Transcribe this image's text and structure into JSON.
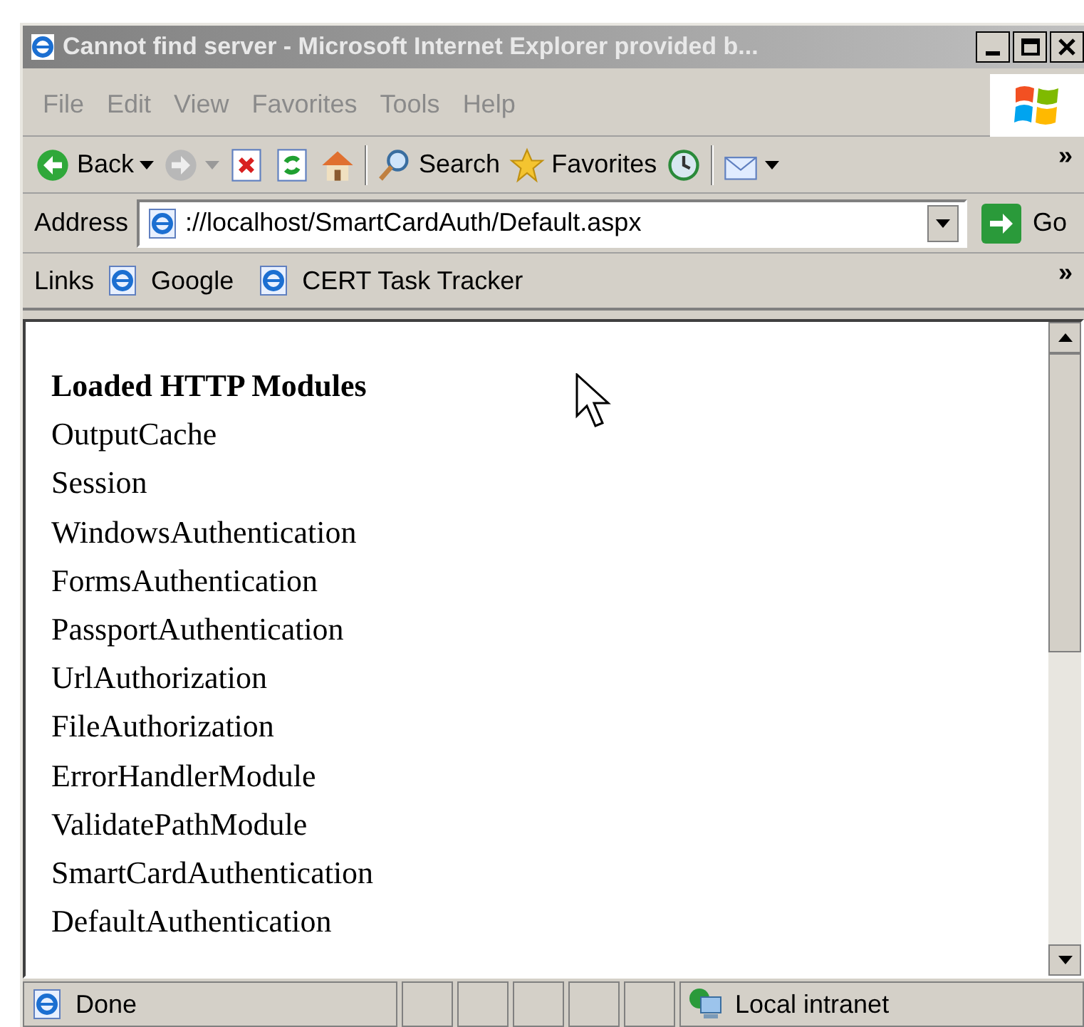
{
  "window": {
    "title": "Cannot find server - Microsoft Internet Explorer provided b..."
  },
  "menu": [
    "File",
    "Edit",
    "View",
    "Favorites",
    "Tools",
    "Help"
  ],
  "toolbar": [
    {
      "kind": "back",
      "label": "Back",
      "disabled": false
    },
    {
      "kind": "forward",
      "disabled": true
    },
    {
      "kind": "stop"
    },
    {
      "kind": "refresh"
    },
    {
      "kind": "home"
    },
    {
      "kind": "search",
      "label": "Search"
    },
    {
      "kind": "favorites",
      "label": "Favorites"
    },
    {
      "kind": "history"
    },
    {
      "kind": "mail"
    }
  ],
  "toolbar_more": "»",
  "address": {
    "label": "Address",
    "value": "://localhost/SmartCardAuth/Default.aspx",
    "go": "Go"
  },
  "links": {
    "label": "Links",
    "items": [
      "Google",
      "CERT Task Tracker"
    ],
    "more": "»"
  },
  "content": {
    "heading": "Loaded HTTP Modules",
    "items": [
      "OutputCache",
      "Session",
      "WindowsAuthentication",
      "FormsAuthentication",
      "PassportAuthentication",
      "UrlAuthorization",
      "FileAuthorization",
      "ErrorHandlerModule",
      "ValidatePathModule",
      "SmartCardAuthentication",
      "DefaultAuthentication"
    ]
  },
  "status_bar": {
    "text": "Done",
    "zone": "Local intranet"
  }
}
